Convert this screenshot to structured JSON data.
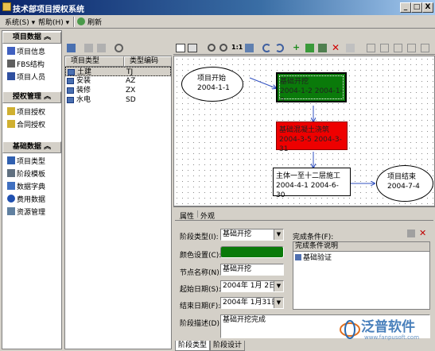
{
  "window": {
    "title": "技术部项目授权系统",
    "btn_min": "_",
    "btn_max": "□",
    "btn_close": "X"
  },
  "menu": {
    "system": "系统(S) ▾",
    "help": "帮助(H) ▾",
    "refresh": "刷新"
  },
  "sidebar": {
    "sections": [
      {
        "title": "项目数据",
        "items": [
          "项目信息",
          "FBS结构",
          "项目人员"
        ]
      },
      {
        "title": "授权管理",
        "items": [
          "项目授权",
          "合同授权"
        ]
      },
      {
        "title": "基础数据",
        "items": [
          "项目类型",
          "阶段模板",
          "数据字典",
          "费用数据",
          "资源管理"
        ]
      }
    ]
  },
  "type_table": {
    "headers": [
      "项目类型",
      "类型编码"
    ],
    "rows": [
      {
        "name": "土建",
        "code": "TJ"
      },
      {
        "name": "安装",
        "code": "AZ"
      },
      {
        "name": "装修",
        "code": "ZX"
      },
      {
        "name": "水电",
        "code": "SD"
      }
    ]
  },
  "diagram": {
    "start": {
      "title": "项目开始",
      "date": "2004-1-1"
    },
    "n1": {
      "title": "基础开挖",
      "dates": "2004-1-2 2004-1-3"
    },
    "n2": {
      "title": "基础混凝土浇筑",
      "dates": "2004-3-5  2004-3-31"
    },
    "n3": {
      "title": "主体一至十二层施工",
      "dates": "2004-4-1 2004-6-30"
    },
    "end": {
      "title": "项目结束",
      "date": "2004-7-4"
    }
  },
  "props": {
    "tabs": [
      "属性",
      "外观"
    ],
    "stage_type_label": "阶段类型(I):",
    "stage_type_value": "基础开挖",
    "color_label": "颜色设置(C):",
    "node_name_label": "节点名称(N):",
    "node_name_value": "基础开挖",
    "start_label": "起始日期(S):",
    "start_value": "2004年 1月 2日",
    "end_label": "结束日期(F):",
    "end_value": "2004年 1月31日",
    "desc_label": "阶段描述(D):",
    "desc_value": "基础开挖完成",
    "cond_label": "完成条件(F):",
    "cond_header": "完成条件说明",
    "cond_item": "基础验证",
    "bottom_tabs": [
      "阶段类型",
      "阶段设计"
    ]
  },
  "watermark": {
    "name": "泛普软件",
    "url": "www.fanpusoft.com"
  },
  "colors": {
    "node_green": "#0a7a0a",
    "node_red": "#ee0000",
    "field_green": "#0a7a0a"
  }
}
